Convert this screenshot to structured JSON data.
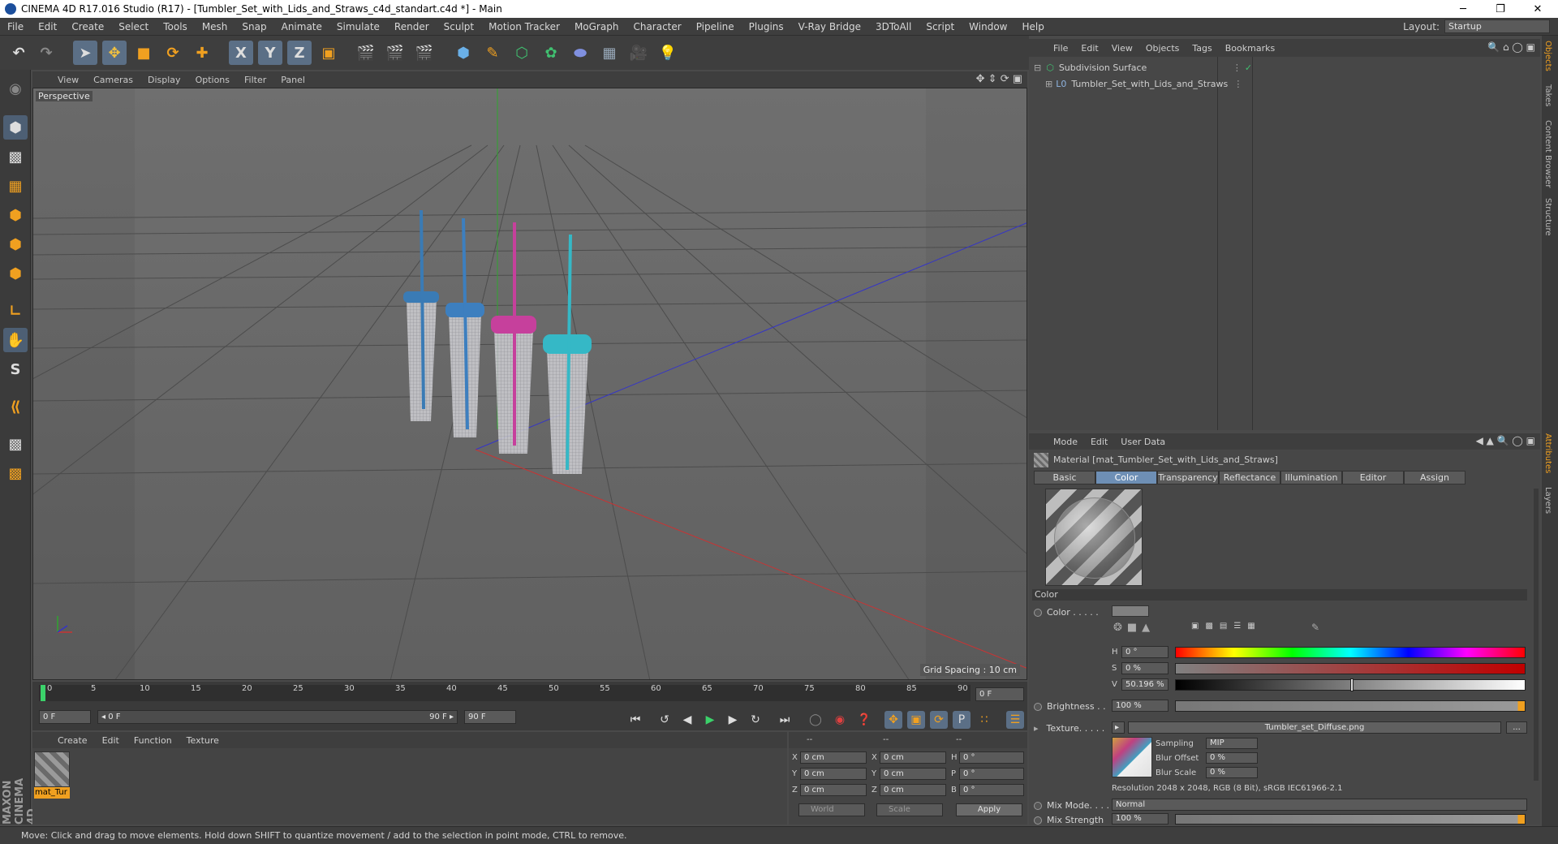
{
  "window": {
    "title": "CINEMA 4D R17.016 Studio (R17) - [Tumbler_Set_with_Lids_and_Straws_c4d_standart.c4d *] - Main",
    "minimize": "─",
    "restore": "❐",
    "close": "✕"
  },
  "menubar": {
    "items": [
      "File",
      "Edit",
      "Create",
      "Select",
      "Tools",
      "Mesh",
      "Snap",
      "Animate",
      "Simulate",
      "Render",
      "Sculpt",
      "Motion Tracker",
      "MoGraph",
      "Character",
      "Pipeline",
      "Plugins",
      "V-Ray Bridge",
      "3DToAll",
      "Script",
      "Window",
      "Help"
    ],
    "layout_label": "Layout:",
    "layout_value": "Startup"
  },
  "toolbar": {
    "axis_x": "X",
    "axis_y": "Y",
    "axis_z": "Z"
  },
  "viewport": {
    "menu": [
      "View",
      "Cameras",
      "Display",
      "Options",
      "Filter",
      "Panel"
    ],
    "label": "Perspective",
    "grid_spacing": "Grid Spacing : 10 cm",
    "tumblers": [
      {
        "color": "#3a7bb5"
      },
      {
        "color": "#3d7fbf"
      },
      {
        "color": "#c6409c"
      },
      {
        "color": "#35b8c6"
      }
    ]
  },
  "timeline": {
    "ticks": [
      "0",
      "5",
      "10",
      "15",
      "20",
      "25",
      "30",
      "35",
      "40",
      "45",
      "50",
      "55",
      "60",
      "65",
      "70",
      "75",
      "80",
      "85",
      "90"
    ],
    "current_frame": "0 F",
    "start_field": "0 F",
    "range_start": "◂ 0 F",
    "range_end": "90 F ▸",
    "end_field": "90 F"
  },
  "material_manager": {
    "menu": [
      "Create",
      "Edit",
      "Function",
      "Texture"
    ],
    "material_name": "mat_Tur"
  },
  "coordinates": {
    "header": [
      "--",
      "--",
      "--"
    ],
    "rows": [
      {
        "l1": "X",
        "v1": "0 cm",
        "l2": "X",
        "v2": "0 cm",
        "l3": "H",
        "v3": "0 °"
      },
      {
        "l1": "Y",
        "v1": "0 cm",
        "l2": "Y",
        "v2": "0 cm",
        "l3": "P",
        "v3": "0 °"
      },
      {
        "l1": "Z",
        "v1": "0 cm",
        "l2": "Z",
        "v2": "0 cm",
        "l3": "B",
        "v3": "0 °"
      }
    ],
    "world": "World",
    "scale": "Scale",
    "apply": "Apply"
  },
  "status": "Move: Click and drag to move elements. Hold down SHIFT to quantize movement / add to the selection in point mode, CTRL to remove.",
  "object_manager": {
    "menu": [
      "File",
      "Edit",
      "View",
      "Objects",
      "Tags",
      "Bookmarks"
    ],
    "objects": [
      {
        "name": "Subdivision Surface",
        "check": "✓"
      },
      {
        "name": "Tumbler_Set_with_Lids_and_Straws",
        "check": ""
      }
    ]
  },
  "attributes": {
    "menu": [
      "Mode",
      "Edit",
      "User Data"
    ],
    "material_title": "Material [mat_Tumbler_Set_with_Lids_and_Straws]",
    "tabs": [
      "Basic",
      "Color",
      "Transparency",
      "Reflectance",
      "Illumination",
      "Editor",
      "Assign"
    ],
    "active_tab": "Color",
    "section": "Color",
    "color_label": "Color . . . . .",
    "h_label": "H",
    "h_value": "0 °",
    "s_label": "S",
    "s_value": "0 %",
    "v_label": "V",
    "v_value": "50.196 %",
    "v_level": 0.50196,
    "brightness_label": "Brightness . .",
    "brightness_value": "100 %",
    "texture_label": "Texture. . . . .",
    "texture_file": "Tumbler_set_Diffuse.png",
    "texture_more": "...",
    "sampling_label": "Sampling",
    "sampling_value": "MIP",
    "blur_offset_label": "Blur Offset",
    "blur_offset_value": "0 %",
    "blur_scale_label": "Blur Scale",
    "blur_scale_value": "0 %",
    "resolution": "Resolution 2048 x 2048, RGB (8 Bit), sRGB IEC61966-2.1",
    "mix_mode_label": "Mix Mode. . . .",
    "mix_mode_value": "Normal",
    "mix_strength_label": "Mix Strength",
    "mix_strength_value": "100 %"
  },
  "right_tabs": [
    "Objects",
    "Takes",
    "Content Browser",
    "Structure",
    "Attributes",
    "Layers"
  ],
  "brand": "MAXON CINEMA 4D"
}
